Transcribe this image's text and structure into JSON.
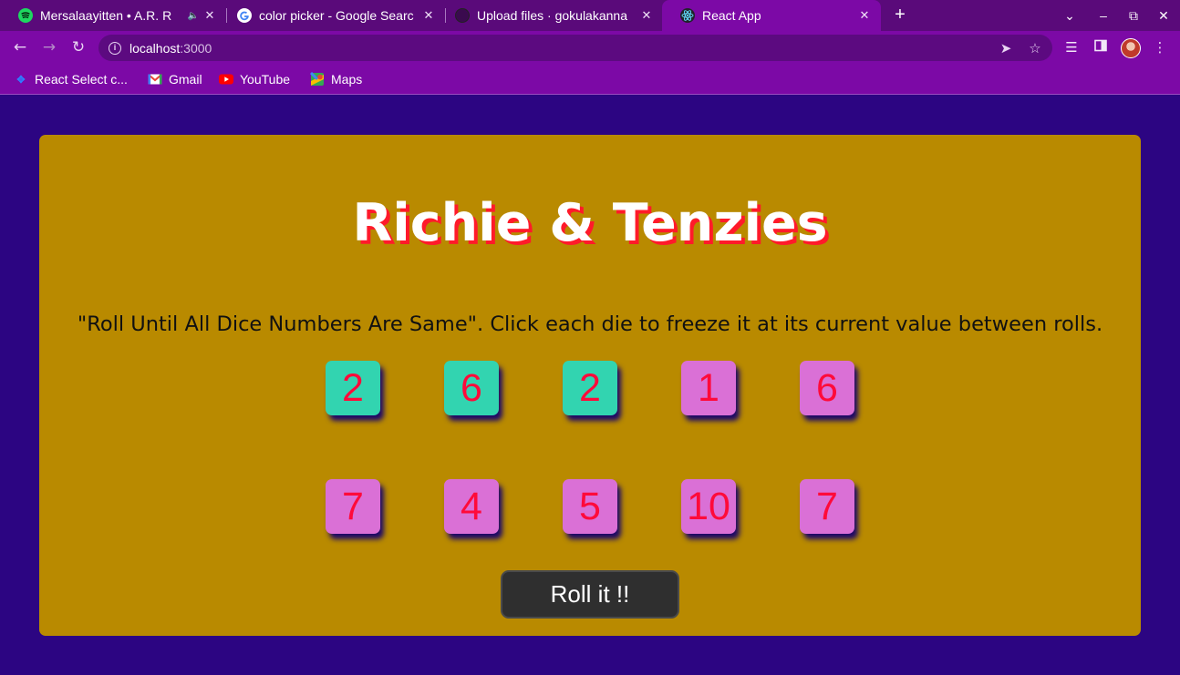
{
  "browser": {
    "tabs": [
      {
        "title": "Mersalaayitten • A.R. R",
        "icon": "spotify-icon",
        "audio": "🔈",
        "close": "✕",
        "active": false
      },
      {
        "title": "color picker - Google Searc",
        "icon": "google-icon",
        "close": "✕",
        "active": false
      },
      {
        "title": "Upload files · gokulakanna",
        "icon": "github-icon",
        "close": "✕",
        "active": false
      },
      {
        "title": "React App",
        "icon": "react-icon",
        "close": "✕",
        "active": true
      }
    ],
    "new_tab": "+",
    "window_controls": {
      "tab_search": "⌄",
      "minimize": "–",
      "restore": "⧉",
      "close": "✕"
    },
    "address": {
      "host": "localhost",
      "port": ":3000"
    },
    "bookmarks": [
      {
        "label": "React Select c...",
        "icon": "react-select-icon"
      },
      {
        "label": "Gmail",
        "icon": "gmail-icon"
      },
      {
        "label": "YouTube",
        "icon": "youtube-icon"
      },
      {
        "label": "Maps",
        "icon": "maps-icon"
      }
    ]
  },
  "app": {
    "title": "Richie & Tenzies",
    "instructions": "\"Roll Until All Dice Numbers Are Same\". Click each die to freeze it at its current value between rolls.",
    "dice": [
      {
        "value": "2",
        "held": true
      },
      {
        "value": "6",
        "held": true
      },
      {
        "value": "2",
        "held": true
      },
      {
        "value": "1",
        "held": false
      },
      {
        "value": "6",
        "held": false
      },
      {
        "value": "7",
        "held": false
      },
      {
        "value": "4",
        "held": false
      },
      {
        "value": "5",
        "held": false
      },
      {
        "value": "10",
        "held": false
      },
      {
        "value": "7",
        "held": false
      }
    ],
    "roll_button": "Roll it !!"
  },
  "colors": {
    "page_background": "#2c0582",
    "card_background": "#b98a00",
    "die_held": "#32d4b0",
    "die_free": "#da70d6",
    "die_number": "#ff0a3a",
    "title_shadow": "#ff1a2a",
    "browser_frame": "#7c09a6"
  }
}
